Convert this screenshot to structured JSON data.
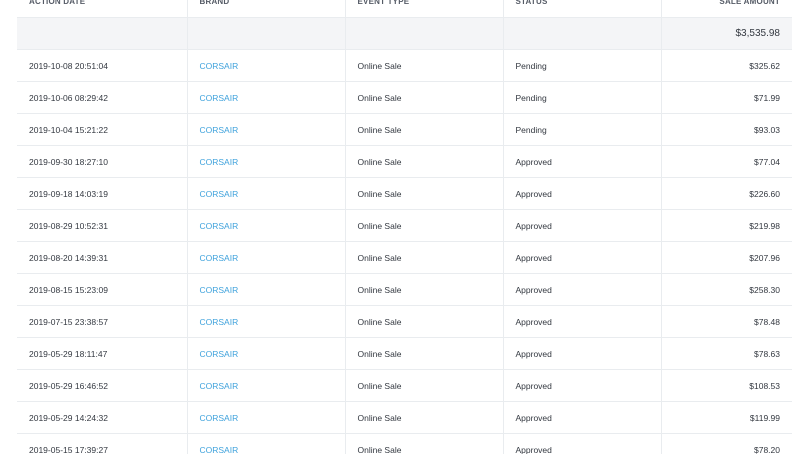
{
  "columns": {
    "action_date": "ACTION DATE",
    "brand": "BRAND",
    "event_type": "EVENT TYPE",
    "status": "STATUS",
    "sale_amount": "SALE AMOUNT"
  },
  "total": {
    "sale_amount": "$3,535.98"
  },
  "rows": [
    {
      "action_date": "2019-10-08 20:51:04",
      "brand": "CORSAIR",
      "event_type": "Online Sale",
      "status": "Pending",
      "sale_amount": "$325.62"
    },
    {
      "action_date": "2019-10-06 08:29:42",
      "brand": "CORSAIR",
      "event_type": "Online Sale",
      "status": "Pending",
      "sale_amount": "$71.99"
    },
    {
      "action_date": "2019-10-04 15:21:22",
      "brand": "CORSAIR",
      "event_type": "Online Sale",
      "status": "Pending",
      "sale_amount": "$93.03"
    },
    {
      "action_date": "2019-09-30 18:27:10",
      "brand": "CORSAIR",
      "event_type": "Online Sale",
      "status": "Approved",
      "sale_amount": "$77.04"
    },
    {
      "action_date": "2019-09-18 14:03:19",
      "brand": "CORSAIR",
      "event_type": "Online Sale",
      "status": "Approved",
      "sale_amount": "$226.60"
    },
    {
      "action_date": "2019-08-29 10:52:31",
      "brand": "CORSAIR",
      "event_type": "Online Sale",
      "status": "Approved",
      "sale_amount": "$219.98"
    },
    {
      "action_date": "2019-08-20 14:39:31",
      "brand": "CORSAIR",
      "event_type": "Online Sale",
      "status": "Approved",
      "sale_amount": "$207.96"
    },
    {
      "action_date": "2019-08-15 15:23:09",
      "brand": "CORSAIR",
      "event_type": "Online Sale",
      "status": "Approved",
      "sale_amount": "$258.30"
    },
    {
      "action_date": "2019-07-15 23:38:57",
      "brand": "CORSAIR",
      "event_type": "Online Sale",
      "status": "Approved",
      "sale_amount": "$78.48"
    },
    {
      "action_date": "2019-05-29 18:11:47",
      "brand": "CORSAIR",
      "event_type": "Online Sale",
      "status": "Approved",
      "sale_amount": "$78.63"
    },
    {
      "action_date": "2019-05-29 16:46:52",
      "brand": "CORSAIR",
      "event_type": "Online Sale",
      "status": "Approved",
      "sale_amount": "$108.53"
    },
    {
      "action_date": "2019-05-29 14:24:32",
      "brand": "CORSAIR",
      "event_type": "Online Sale",
      "status": "Approved",
      "sale_amount": "$119.99"
    },
    {
      "action_date": "2019-05-15 17:39:27",
      "brand": "CORSAIR",
      "event_type": "Online Sale",
      "status": "Approved",
      "sale_amount": "$78.20"
    }
  ]
}
